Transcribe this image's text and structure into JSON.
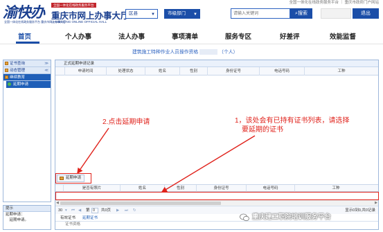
{
  "header": {
    "logo_text": "渝快办",
    "logo_subtitle": "全国一体化在线政务服务平台 重庆市网上办事大厅",
    "hall_tag": "全国一体化在线政务服务平台",
    "hall_title": "重庆市网上办事大厅",
    "hall_title_en": "CHONGQING ONLINE OFFICIAL HALL",
    "region_label": "区县",
    "dept_label": "市级部门",
    "top_links": "全国一体化在线政务服务平台 ｜ 重庆市政府门户网站",
    "search_placeholder": "请输入关键词",
    "search_button": "搜索",
    "logout_button": "退出"
  },
  "nav": {
    "items": [
      "首页",
      "个人办事",
      "法人办事",
      "事项清单",
      "服务专区",
      "好差评",
      "效能监督"
    ],
    "active_index": 0
  },
  "page_subtitle": {
    "prefix": "建筑施工特种作业人员操作资格",
    "suffix": "（个人）"
  },
  "sidebar": {
    "groups": [
      {
        "label": "证书查询",
        "chevron": "≫",
        "selected": false
      },
      {
        "label": "动态管理",
        "chevron": "≪",
        "selected": false
      },
      {
        "label": "继续教育",
        "chevron": "",
        "selected": true
      }
    ],
    "leaf": "延期申请"
  },
  "tips": {
    "title": "提示",
    "lines": [
      "延期申请：",
      "　延期申请。"
    ]
  },
  "main": {
    "panel_title": "正式延期申请记录",
    "grid1_columns": [
      "申请时间",
      "处理状态",
      "姓名",
      "性别",
      "身份证号",
      "电话号码",
      "工种"
    ],
    "pager": {
      "page_size": "30",
      "page_prefix": "第",
      "page_value": "0",
      "page_total": "共0页",
      "summary": "显示0到0,共0记录"
    },
    "tabs": [
      "有效证书",
      "延期证书"
    ],
    "qualification_label": "证书资格",
    "apply_button": "延期申请",
    "grid2_columns": [
      "是否有照片",
      "姓名",
      "性别",
      "身份证号",
      "电话号码",
      "工种"
    ]
  },
  "annotations": {
    "step2": "2.点击延期申请",
    "step1_line1": "1，该处会有已持有证书列表，请选择",
    "step1_line2": "要延期的证书",
    "color": "#e0221b"
  },
  "watermark": "重庆建工职院培训服务平台",
  "colors": {
    "brand_blue": "#1b4ea8",
    "accent_red": "#e0221b",
    "panel_border": "#9db7da"
  }
}
